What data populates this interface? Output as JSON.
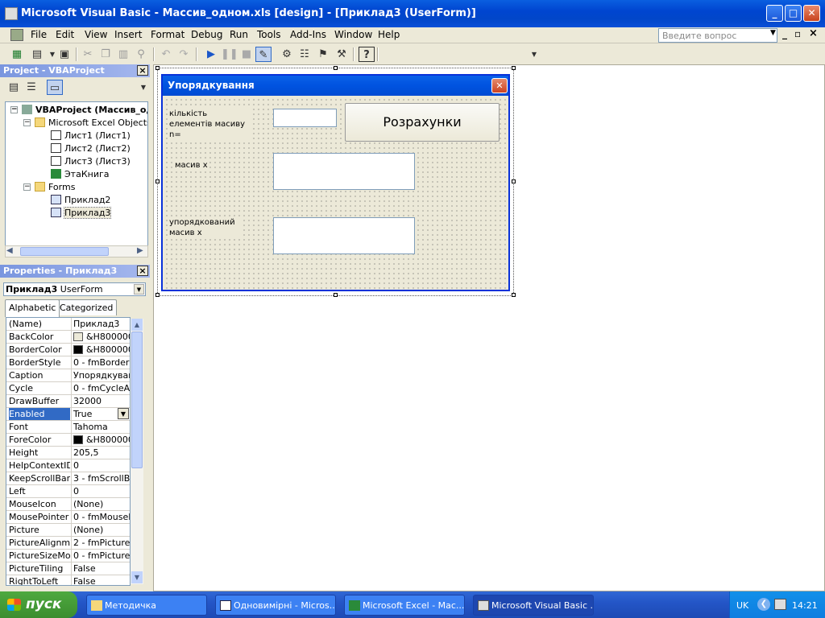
{
  "title": "Microsoft Visual Basic - Массив_одном.xls [design] - [Приклад3 (UserForm)]",
  "window_buttons": {
    "min": "_",
    "max": "□",
    "close": "✕"
  },
  "menu": [
    "File",
    "Edit",
    "View",
    "Insert",
    "Format",
    "Debug",
    "Run",
    "Tools",
    "Add-Ins",
    "Window",
    "Help"
  ],
  "ask_placeholder": "Введите вопрос",
  "mdi_buttons": [
    "_",
    "▫",
    "×"
  ],
  "project": {
    "header": "Project - VBAProject",
    "tree": {
      "root": "VBAProject (Массив_од",
      "excel_objects": "Microsoft Excel Objects",
      "sheets": [
        "Лист1 (Лист1)",
        "Лист2 (Лист2)",
        "Лист3 (Лист3)",
        "ЭтаКнига"
      ],
      "forms": "Forms",
      "form_items": [
        "Приклад2",
        "Приклад3"
      ]
    }
  },
  "properties": {
    "header": "Properties - Приклад3",
    "object_name": "Приклад3",
    "object_type": "UserForm",
    "tabs": [
      "Alphabetic",
      "Categorized"
    ],
    "rows": [
      {
        "name": "(Name)",
        "value": "Приклад3"
      },
      {
        "name": "BackColor",
        "value": "&H8000000"
      },
      {
        "name": "BorderColor",
        "value": "&H8000001"
      },
      {
        "name": "BorderStyle",
        "value": "0 - fmBorderSt"
      },
      {
        "name": "Caption",
        "value": "Упорядкувани"
      },
      {
        "name": "Cycle",
        "value": "0 - fmCycleAllF"
      },
      {
        "name": "DrawBuffer",
        "value": "32000"
      },
      {
        "name": "Enabled",
        "value": "True"
      },
      {
        "name": "Font",
        "value": "Tahoma"
      },
      {
        "name": "ForeColor",
        "value": "&H8000001"
      },
      {
        "name": "Height",
        "value": "205,5"
      },
      {
        "name": "HelpContextID",
        "value": "0"
      },
      {
        "name": "KeepScrollBarsV",
        "value": "3 - fmScrollBar"
      },
      {
        "name": "Left",
        "value": "0"
      },
      {
        "name": "MouseIcon",
        "value": "(None)"
      },
      {
        "name": "MousePointer",
        "value": "0 - fmMousePo"
      },
      {
        "name": "Picture",
        "value": "(None)"
      },
      {
        "name": "PictureAlignmen",
        "value": "2 - fmPictureAl"
      },
      {
        "name": "PictureSizeMode",
        "value": "0 - fmPictureSi"
      },
      {
        "name": "PictureTiling",
        "value": "False"
      },
      {
        "name": "RightToLeft",
        "value": "False"
      }
    ]
  },
  "userform": {
    "title": "Упорядкування",
    "label_count": "кількість елементів масиву  n=",
    "label_array": "масив  х",
    "label_sorted": "упорядкований масив х",
    "button": "Розрахунки"
  },
  "taskbar": {
    "start": "пуск",
    "tasks": [
      "Методичка",
      "Одновимірні - Micros...",
      "Microsoft Excel - Мас...",
      "Microsoft Visual Basic ..."
    ],
    "lang": "UK",
    "time": "14:21"
  },
  "colors": {
    "selection": "#316ac5",
    "titlebar": "#0054e3",
    "start": "#3b8d2f"
  }
}
